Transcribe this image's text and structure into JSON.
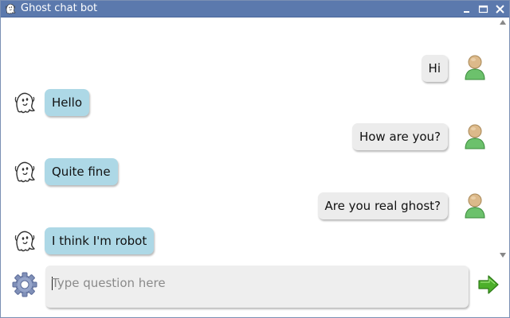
{
  "window": {
    "title": "Ghost chat bot",
    "icon": "ghost-icon",
    "controls": [
      "minimize-icon",
      "maximize-icon",
      "close-icon"
    ],
    "title_bar_color": "#5b79ad"
  },
  "messages": [
    {
      "sender": "user",
      "text": "Hi"
    },
    {
      "sender": "bot",
      "text": "Hello"
    },
    {
      "sender": "user",
      "text": "How are you?"
    },
    {
      "sender": "bot",
      "text": "Quite fine"
    },
    {
      "sender": "user",
      "text": "Are you real ghost?"
    },
    {
      "sender": "bot",
      "text": "I think I'm robot"
    }
  ],
  "colors": {
    "bot_bubble": "#add8e6",
    "user_bubble": "#ececec",
    "input_background": "#eeeeee"
  },
  "input": {
    "placeholder": "Type question here",
    "value": ""
  },
  "icons": {
    "settings": "gear-icon",
    "send": "send-arrow-icon",
    "user_avatar": "user-avatar-icon",
    "bot_avatar": "ghost-icon"
  }
}
